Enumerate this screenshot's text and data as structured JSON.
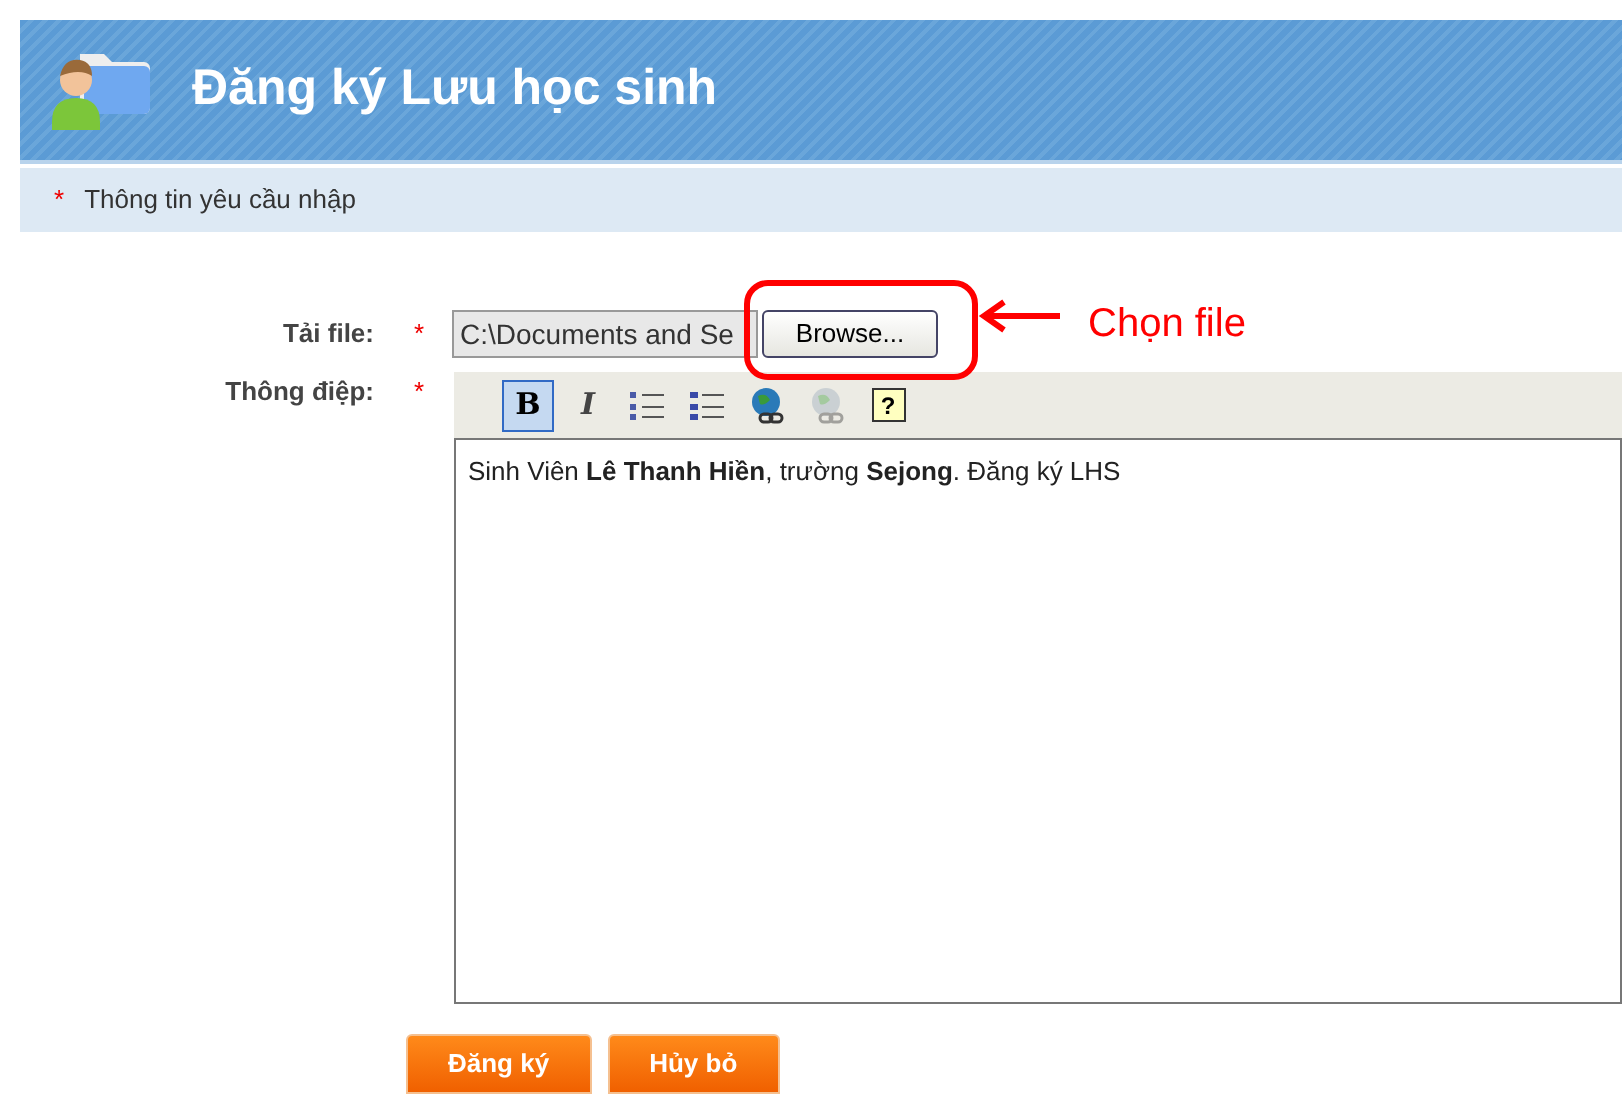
{
  "header": {
    "title": "Đăng ký Lưu học sinh"
  },
  "notice": {
    "mark": "*",
    "text": "Thông tin yêu cầu nhập"
  },
  "form": {
    "file": {
      "label": "Tải file:",
      "required_mark": "*",
      "value": "C:\\Documents and Se",
      "browse": "Browse..."
    },
    "message": {
      "label": "Thông điệp:",
      "required_mark": "*",
      "toolbar": [
        {
          "kind": "bold",
          "label": "B",
          "selected": true,
          "disabled": false
        },
        {
          "kind": "italic",
          "label": "I",
          "selected": false,
          "disabled": false
        },
        {
          "kind": "ordered-list",
          "selected": false,
          "disabled": false
        },
        {
          "kind": "bullet-list",
          "selected": false,
          "disabled": false
        },
        {
          "kind": "link",
          "selected": false,
          "disabled": false
        },
        {
          "kind": "unlink",
          "selected": false,
          "disabled": true
        },
        {
          "kind": "help",
          "label": "?",
          "selected": false,
          "disabled": false
        }
      ],
      "value": "Sinh Viên **Lê Thanh Hiền**, trường **Sejong**. Đăng ký LHS"
    }
  },
  "buttons": [
    "Đăng ký",
    "Hủy bỏ"
  ],
  "annotation": {
    "text": "Chọn file"
  }
}
